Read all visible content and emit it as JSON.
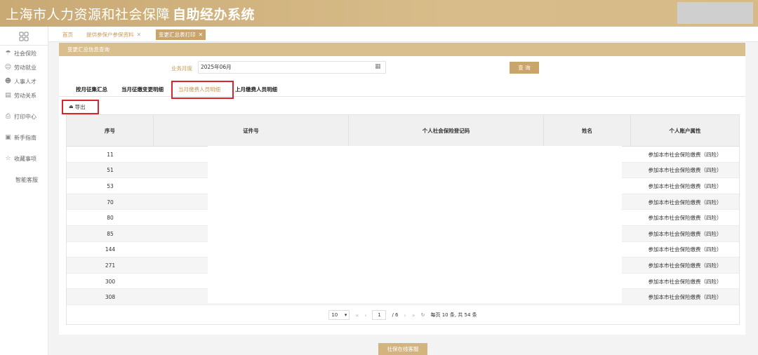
{
  "header": {
    "title_main": "上海市人力资源和社会保障",
    "title_sub": "自助经办系统"
  },
  "sidebar": {
    "items": [
      {
        "label": "社会保险",
        "icon": "umbrella-icon"
      },
      {
        "label": "劳动就业",
        "icon": "person-icon"
      },
      {
        "label": "人事人才",
        "icon": "people-icon"
      },
      {
        "label": "劳动关系",
        "icon": "document-icon"
      },
      {
        "label": "打印中心",
        "icon": "printer-icon"
      },
      {
        "label": "新手指南",
        "icon": "guide-icon"
      },
      {
        "label": "收藏事项",
        "icon": "star-icon"
      },
      {
        "label": "智能客服",
        "icon": ""
      }
    ]
  },
  "tabs": [
    {
      "label": "首页"
    },
    {
      "label": "提供参保户参保资料"
    },
    {
      "label": "变更汇总表打印"
    }
  ],
  "section_title": "变更汇总信息查询",
  "form": {
    "month_label": "业务月度",
    "month_value": "2025年06月",
    "query_label": "查 询"
  },
  "subtabs": [
    {
      "label": "按月征集汇总"
    },
    {
      "label": "当月征缴变更明细"
    },
    {
      "label": "当月缴费人员明细"
    },
    {
      "label": "上月缴费人员明细"
    }
  ],
  "export_label": "导出",
  "table": {
    "columns": [
      "序号",
      "证件号",
      "个人社会保险登记码",
      "姓名",
      "个人账户属性"
    ],
    "rows": [
      {
        "no": "11",
        "attr": "参加本市社会保险缴费（四险）"
      },
      {
        "no": "51",
        "attr": "参加本市社会保险缴费（四险）"
      },
      {
        "no": "53",
        "attr": "参加本市社会保险缴费（四险）"
      },
      {
        "no": "70",
        "attr": "参加本市社会保险缴费（四险）"
      },
      {
        "no": "80",
        "attr": "参加本市社会保险缴费（四险）"
      },
      {
        "no": "85",
        "attr": "参加本市社会保险缴费（四险）"
      },
      {
        "no": "144",
        "attr": "参加本市社会保险缴费（四险）"
      },
      {
        "no": "271",
        "attr": "参加本市社会保险缴费（四险）"
      },
      {
        "no": "300",
        "attr": "参加本市社会保险缴费（四险）"
      },
      {
        "no": "308",
        "attr": "参加本市社会保险缴费（四险）"
      }
    ]
  },
  "pager": {
    "page_size": "10",
    "current": "1",
    "total_pages": "/ 6",
    "summary": "每页 10 条, 共 54 条"
  },
  "online_service": "社保在线客服"
}
